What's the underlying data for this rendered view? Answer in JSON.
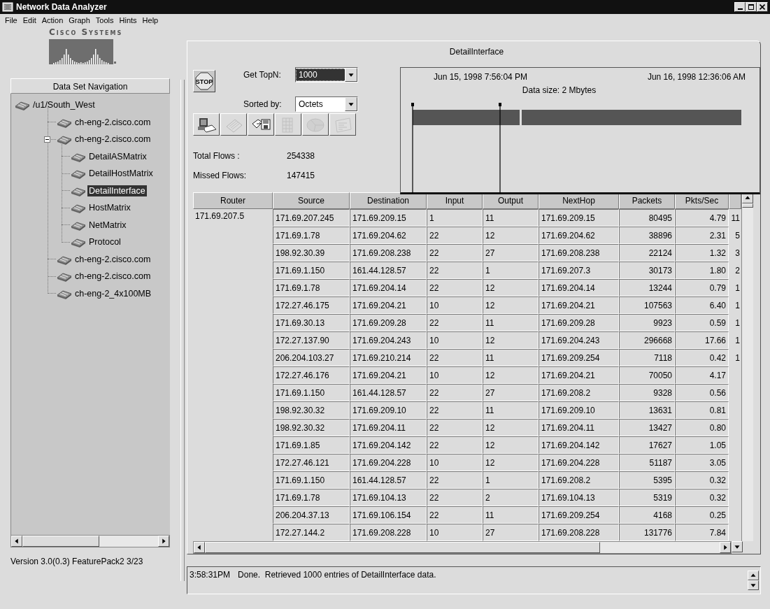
{
  "window": {
    "title": "Network Data Analyzer"
  },
  "menu": [
    "File",
    "Edit",
    "Action",
    "Graph",
    "Tools",
    "Hints",
    "Help"
  ],
  "logo": {
    "text": "Cisco Systems"
  },
  "navigation": {
    "title": "Data Set Navigation",
    "tree": [
      {
        "label": "/u1/South_West",
        "selected": false,
        "children": [
          {
            "label": "ch-eng-2.cisco.com",
            "selected": false
          },
          {
            "label": "ch-eng-2.cisco.com",
            "selected": false,
            "expanded": true,
            "children": [
              {
                "label": "DetailASMatrix",
                "selected": false
              },
              {
                "label": "DetailHostMatrix",
                "selected": false
              },
              {
                "label": "DetailInterface",
                "selected": true
              },
              {
                "label": "HostMatrix",
                "selected": false
              },
              {
                "label": "NetMatrix",
                "selected": false
              },
              {
                "label": "Protocol",
                "selected": false
              }
            ]
          },
          {
            "label": "ch-eng-2.cisco.com",
            "selected": false
          },
          {
            "label": "ch-eng-2.cisco.com",
            "selected": false
          },
          {
            "label": "ch-eng-2_4x100MB",
            "selected": false
          }
        ]
      }
    ]
  },
  "version": "Version 3.0(0.3) FeaturePack2 3/23",
  "panel": {
    "title": "DetailInterface",
    "stop_button": "STOP",
    "get_topn": {
      "label": "Get TopN:",
      "value": "1000",
      "focused": true
    },
    "sorted_by": {
      "label": "Sorted by:",
      "value": "Octets",
      "focused": false
    },
    "toolbar": [
      {
        "kind": "computer",
        "disabled": false
      },
      {
        "kind": "notepad",
        "disabled": true
      },
      {
        "kind": "save",
        "disabled": false
      },
      {
        "kind": "table",
        "disabled": true
      },
      {
        "kind": "pie",
        "disabled": true
      },
      {
        "kind": "report",
        "disabled": true
      }
    ],
    "stats": [
      {
        "label": "Total Flows :",
        "value": "254338"
      },
      {
        "label": "Missed Flows:",
        "value": "147415"
      }
    ],
    "timeline": {
      "start": "Jun 15, 1998 7:56:04 PM",
      "end": "Jun 16, 1998 12:36:06 AM",
      "data_size": "Data size: 2 Mbytes"
    }
  },
  "table": {
    "columns": [
      "Router",
      "Source",
      "Destination",
      "Input",
      "Output",
      "NextHop",
      "Packets",
      "Pkts/Sec"
    ],
    "rows": [
      [
        "171.69.207.5",
        "171.69.207.245",
        "171.69.209.15",
        "1",
        "11",
        "171.69.209.15",
        "80495",
        "4.79",
        "11"
      ],
      [
        "",
        "171.69.1.78",
        "171.69.204.62",
        "22",
        "12",
        "171.69.204.62",
        "38896",
        "2.31",
        "5"
      ],
      [
        "",
        "198.92.30.39",
        "171.69.208.238",
        "22",
        "27",
        "171.69.208.238",
        "22124",
        "1.32",
        "3"
      ],
      [
        "",
        "171.69.1.150",
        "161.44.128.57",
        "22",
        "1",
        "171.69.207.3",
        "30173",
        "1.80",
        "2"
      ],
      [
        "",
        "171.69.1.78",
        "171.69.204.14",
        "22",
        "12",
        "171.69.204.14",
        "13244",
        "0.79",
        "1"
      ],
      [
        "",
        "172.27.46.175",
        "171.69.204.21",
        "10",
        "12",
        "171.69.204.21",
        "107563",
        "6.40",
        "1"
      ],
      [
        "",
        "171.69.30.13",
        "171.69.209.28",
        "22",
        "11",
        "171.69.209.28",
        "9923",
        "0.59",
        "1"
      ],
      [
        "",
        "172.27.137.90",
        "171.69.204.243",
        "10",
        "12",
        "171.69.204.243",
        "296668",
        "17.66",
        "1"
      ],
      [
        "",
        "206.204.103.27",
        "171.69.210.214",
        "22",
        "11",
        "171.69.209.254",
        "7118",
        "0.42",
        "1"
      ],
      [
        "",
        "172.27.46.176",
        "171.69.204.21",
        "10",
        "12",
        "171.69.204.21",
        "70050",
        "4.17"
      ],
      [
        "",
        "171.69.1.150",
        "161.44.128.57",
        "22",
        "27",
        "171.69.208.2",
        "9328",
        "0.56"
      ],
      [
        "",
        "198.92.30.32",
        "171.69.209.10",
        "22",
        "11",
        "171.69.209.10",
        "13631",
        "0.81"
      ],
      [
        "",
        "198.92.30.32",
        "171.69.204.11",
        "22",
        "12",
        "171.69.204.11",
        "13427",
        "0.80"
      ],
      [
        "",
        "171.69.1.85",
        "171.69.204.142",
        "22",
        "12",
        "171.69.204.142",
        "17627",
        "1.05"
      ],
      [
        "",
        "172.27.46.121",
        "171.69.204.228",
        "10",
        "12",
        "171.69.204.228",
        "51187",
        "3.05"
      ],
      [
        "",
        "171.69.1.150",
        "161.44.128.57",
        "22",
        "1",
        "171.69.208.2",
        "5395",
        "0.32"
      ],
      [
        "",
        "171.69.1.78",
        "171.69.104.13",
        "22",
        "2",
        "171.69.104.13",
        "5319",
        "0.32"
      ],
      [
        "",
        "206.204.37.13",
        "171.69.106.154",
        "22",
        "11",
        "171.69.209.254",
        "4168",
        "0.25"
      ],
      [
        "",
        "172.27.144.2",
        "171.69.208.228",
        "10",
        "27",
        "171.69.208.228",
        "131776",
        "7.84"
      ]
    ]
  },
  "status": {
    "time": "3:58:31PM",
    "message": "Done.  Retrieved 1000 entries of DetailInterface data."
  }
}
